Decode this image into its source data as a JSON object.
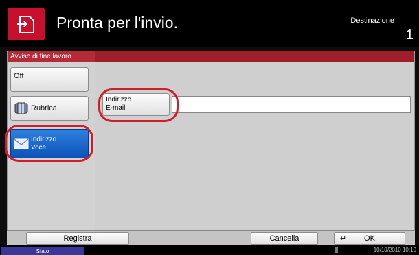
{
  "header": {
    "title": "Pronta per l'invio.",
    "destination_label": "Destinazione",
    "destination_count": "1"
  },
  "panel": {
    "tab_label": "Avviso di fine lavoro",
    "side_buttons": {
      "off": "Off",
      "rubrica": "Rubrica",
      "indirizzo_voce_line1": "Indirizzo",
      "indirizzo_voce_line2": "Voce"
    },
    "email_button_line1": "Indirizzo",
    "email_button_line2": "E-mail",
    "email_value": ""
  },
  "bottom": {
    "registra": "Registra",
    "cancella": "Cancella",
    "ok": "OK"
  },
  "status": {
    "label": "Stato",
    "datetime": "10/10/2010 10:10"
  },
  "colors": {
    "accent_red": "#c8102e",
    "selected_blue": "#1565d8",
    "status_tab": "#3d3699"
  },
  "icons": [
    "home-icon",
    "address-book-icon",
    "envelope-icon",
    "enter-key-icon"
  ]
}
